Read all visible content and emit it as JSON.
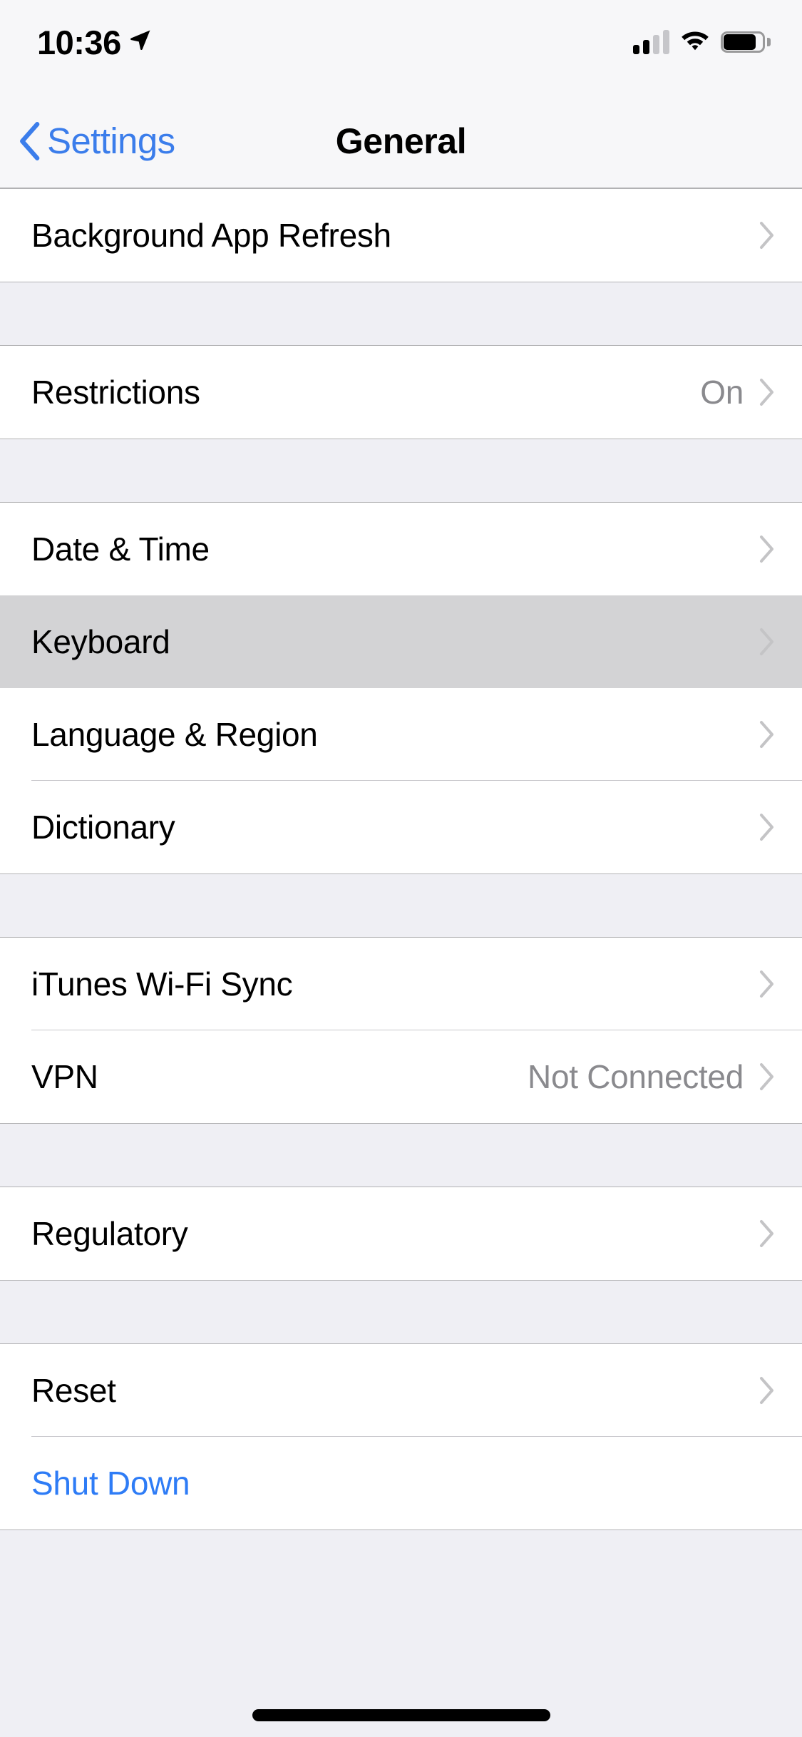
{
  "status_bar": {
    "time": "10:36",
    "location_icon": "location-arrow-icon",
    "signal_icon": "cellular-signal-icon",
    "signal_bars_filled": 2,
    "signal_bars_total": 4,
    "wifi_icon": "wifi-icon",
    "battery_icon": "battery-icon",
    "battery_level_percent": 73
  },
  "nav_bar": {
    "back_label": "Settings",
    "back_icon": "chevron-left-icon",
    "title": "General"
  },
  "colors": {
    "accent_blue": "#3B7DEB",
    "link_blue": "#2E7CF6",
    "background_grey": "#EFEFF4",
    "row_white": "#FFFFFF",
    "highlight_grey": "#D3D3D5",
    "value_grey": "#8A8A8E",
    "separator": "#C8C7CC"
  },
  "sections": [
    {
      "id": "section-background-refresh",
      "rows": [
        {
          "id": "background-app-refresh",
          "label": "Background App Refresh",
          "value": "",
          "chevron": true,
          "highlighted": false,
          "link": false,
          "separator": false
        }
      ]
    },
    {
      "id": "section-restrictions",
      "rows": [
        {
          "id": "restrictions",
          "label": "Restrictions",
          "value": "On",
          "chevron": true,
          "highlighted": false,
          "link": false,
          "separator": false
        }
      ]
    },
    {
      "id": "section-localization",
      "rows": [
        {
          "id": "date-and-time",
          "label": "Date & Time",
          "value": "",
          "chevron": true,
          "highlighted": false,
          "link": false,
          "separator": false
        },
        {
          "id": "keyboard",
          "label": "Keyboard",
          "value": "",
          "chevron": true,
          "highlighted": true,
          "link": false,
          "separator": false
        },
        {
          "id": "language-and-region",
          "label": "Language & Region",
          "value": "",
          "chevron": true,
          "highlighted": false,
          "link": false,
          "separator": true
        },
        {
          "id": "dictionary",
          "label": "Dictionary",
          "value": "",
          "chevron": true,
          "highlighted": false,
          "link": false,
          "separator": false
        }
      ]
    },
    {
      "id": "section-connectivity",
      "rows": [
        {
          "id": "itunes-wifi-sync",
          "label": "iTunes Wi-Fi Sync",
          "value": "",
          "chevron": true,
          "highlighted": false,
          "link": false,
          "separator": true
        },
        {
          "id": "vpn",
          "label": "VPN",
          "value": "Not Connected",
          "chevron": true,
          "highlighted": false,
          "link": false,
          "separator": false
        }
      ]
    },
    {
      "id": "section-regulatory",
      "rows": [
        {
          "id": "regulatory",
          "label": "Regulatory",
          "value": "",
          "chevron": true,
          "highlighted": false,
          "link": false,
          "separator": false
        }
      ]
    },
    {
      "id": "section-reset",
      "rows": [
        {
          "id": "reset",
          "label": "Reset",
          "value": "",
          "chevron": true,
          "highlighted": false,
          "link": false,
          "separator": true
        },
        {
          "id": "shut-down",
          "label": "Shut Down",
          "value": "",
          "chevron": false,
          "highlighted": false,
          "link": true,
          "separator": false
        }
      ]
    }
  ]
}
